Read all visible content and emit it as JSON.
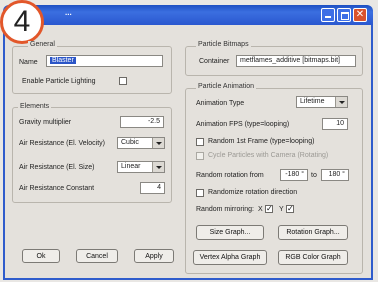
{
  "step_number": "4",
  "window": {
    "title": "..."
  },
  "general": {
    "legend": "General",
    "name_label": "Name",
    "name_value": "Blaster",
    "enable_lighting_label": "Enable Particle Lighting"
  },
  "elements": {
    "legend": "Elements",
    "gravity_label": "Gravity multiplier",
    "gravity_value": "-2.5",
    "air_velocity_label": "Air Resistance (El. Velocity)",
    "air_velocity_value": "Cubic",
    "air_size_label": "Air Resistance (El. Size)",
    "air_size_value": "Linear",
    "air_constant_label": "Air Resistance Constant",
    "air_constant_value": "4"
  },
  "bitmaps": {
    "legend": "Particle Bitmaps",
    "container_label": "Container",
    "container_value": "metflames_additive [bitmaps.bit]"
  },
  "animation": {
    "legend": "Particle Animation",
    "anim_type_label": "Animation Type",
    "anim_type_value": "Lifetime",
    "fps_label": "Animation FPS (type=looping)",
    "fps_value": "10",
    "random_first_frame_label": "Random 1st Frame (type=looping)",
    "cycle_label": "Cycle Particles with Camera (Rotating)",
    "random_rotation_label": "Random rotation from",
    "rot_from": "-180 °",
    "rot_to_label": "to",
    "rot_to": "180 °",
    "randomize_direction_label": "Randomize rotation direction",
    "random_mirroring_label": "Random mirroring:",
    "mirror_x_label": "X",
    "mirror_y_label": "Y",
    "size_graph_label": "Size Graph...",
    "rotation_graph_label": "Rotation Graph...",
    "vertex_alpha_label": "Vertex Alpha Graph",
    "rgb_color_label": "RGB Color Graph"
  },
  "footer": {
    "ok": "Ok",
    "cancel": "Cancel",
    "apply": "Apply"
  }
}
